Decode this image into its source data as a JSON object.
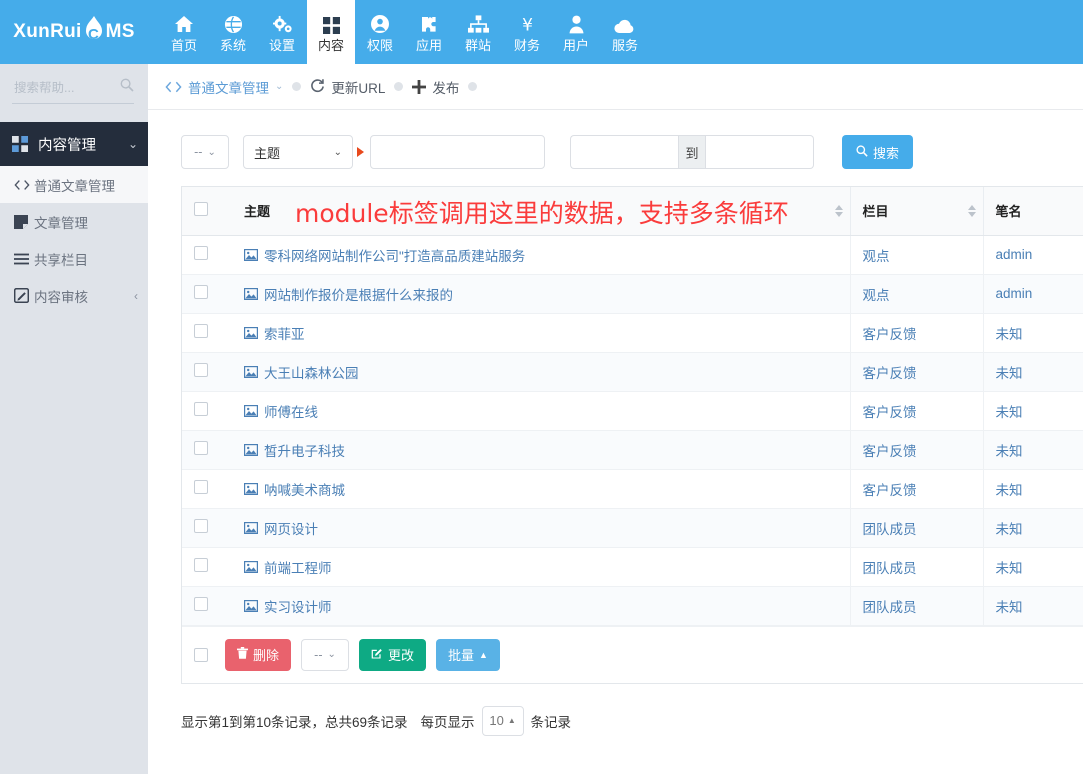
{
  "brand": {
    "name_left": "XunRui",
    "icon": "flame-icon",
    "letter": "C",
    "name_right": "MS"
  },
  "topnav": {
    "items": [
      {
        "label": "首页",
        "icon": "home-icon",
        "active": false
      },
      {
        "label": "系统",
        "icon": "globe-icon",
        "active": false
      },
      {
        "label": "设置",
        "icon": "gears-icon",
        "active": false
      },
      {
        "label": "内容",
        "icon": "grid-icon",
        "active": true
      },
      {
        "label": "权限",
        "icon": "user-circle-icon",
        "active": false
      },
      {
        "label": "应用",
        "icon": "puzzle-icon",
        "active": false
      },
      {
        "label": "群站",
        "icon": "sitemap-icon",
        "active": false
      },
      {
        "label": "财务",
        "icon": "yen-icon",
        "active": false
      },
      {
        "label": "用户",
        "icon": "person-icon",
        "active": false
      },
      {
        "label": "服务",
        "icon": "cloud-icon",
        "active": false
      }
    ]
  },
  "sidebar": {
    "search_placeholder": "搜索帮助...",
    "search_value": "",
    "search_icon": "search-icon",
    "group": {
      "label": "内容管理",
      "icon": "grid-icon",
      "chevron": "chevron-down-icon"
    },
    "items": [
      {
        "label": "普通文章管理",
        "icon": "code-icon",
        "selected": true,
        "chevron": ""
      },
      {
        "label": "文章管理",
        "icon": "note-icon",
        "selected": false,
        "chevron": ""
      },
      {
        "label": "共享栏目",
        "icon": "list-icon",
        "selected": false,
        "chevron": ""
      },
      {
        "label": "内容审核",
        "icon": "pencil-square-icon",
        "selected": false,
        "chevron": "‹"
      }
    ]
  },
  "breadcrumb": {
    "code_icon": "code-icon",
    "title": "普通文章管理",
    "title_chevron": "chevron-double-down-icon",
    "refresh_icon": "refresh-icon",
    "refresh_label": "更新URL",
    "plus_icon": "plus-icon",
    "publish_label": "发布"
  },
  "filters": {
    "scope_select": "--",
    "field_select": "主题",
    "keyword_value": "",
    "keyword_placeholder": "",
    "date_from": "",
    "date_to": "",
    "date_sep": "到",
    "search_icon": "search-icon",
    "search_label": "搜索"
  },
  "annotation": "module标签调用这里的数据，支持多条循环",
  "table": {
    "columns": [
      "主题",
      "栏目",
      "笔名"
    ],
    "rows": [
      {
        "title": "零科网络网站制作公司\"打造高品质建站服务",
        "category": "观点",
        "pen": "admin"
      },
      {
        "title": "网站制作报价是根据什么来报的",
        "category": "观点",
        "pen": "admin"
      },
      {
        "title": "索菲亚",
        "category": "客户反馈",
        "pen": "未知"
      },
      {
        "title": "大王山森林公园",
        "category": "客户反馈",
        "pen": "未知"
      },
      {
        "title": "师傅在线",
        "category": "客户反馈",
        "pen": "未知"
      },
      {
        "title": "皙升电子科技",
        "category": "客户反馈",
        "pen": "未知"
      },
      {
        "title": "呐喊美术商城",
        "category": "客户反馈",
        "pen": "未知"
      },
      {
        "title": "网页设计",
        "category": "团队成员",
        "pen": "未知"
      },
      {
        "title": "前端工程师",
        "category": "团队成员",
        "pen": "未知"
      },
      {
        "title": "实习设计师",
        "category": "团队成员",
        "pen": "未知"
      }
    ]
  },
  "table_footer": {
    "delete_label": "删除",
    "delete_icon": "trash-icon",
    "move_select": "--",
    "edit_label": "更改",
    "edit_icon": "pencil-square-icon",
    "batch_label": "批量",
    "batch_caret": "caret-up-icon"
  },
  "pager": {
    "info": "显示第1到第10条记录，总共69条记录",
    "per_page_label": "每页显示",
    "per_page_value": "10",
    "per_page_caret": "caret-up-icon",
    "records_label": "条记录"
  },
  "colors": {
    "brand_blue": "#45acea",
    "sidebar_bg": "#dfe3e9",
    "sidebar_active": "#242d3c",
    "link_blue": "#4a7fb5",
    "annotation_red": "#fa3c3c",
    "danger": "#e9626d",
    "success": "#0eaa84",
    "info": "#59b2e6"
  }
}
